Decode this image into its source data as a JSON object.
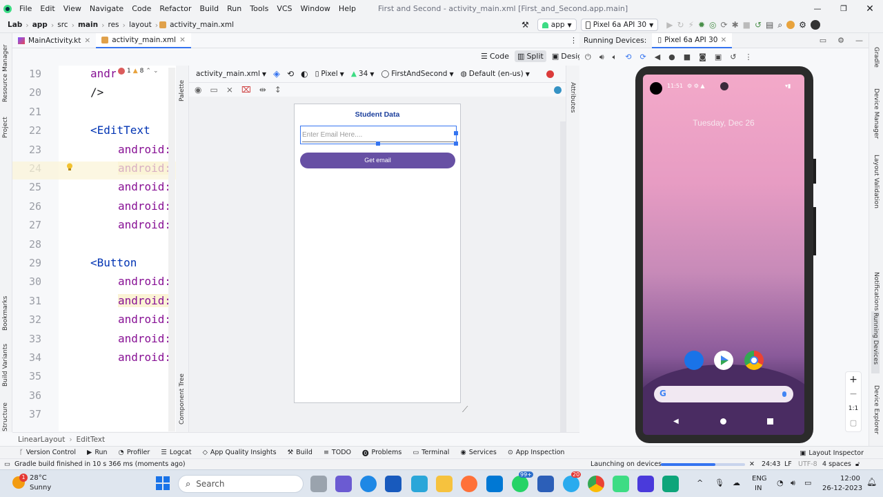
{
  "menu": [
    "File",
    "Edit",
    "View",
    "Navigate",
    "Code",
    "Refactor",
    "Build",
    "Run",
    "Tools",
    "VCS",
    "Window",
    "Help"
  ],
  "window_title": "First and Second - activity_main.xml [First_and_Second.app.main]",
  "breadcrumbs": [
    "Lab",
    "app",
    "src",
    "main",
    "res",
    "layout",
    "activity_main.xml"
  ],
  "run_config": "app",
  "device_selector": "Pixel 6a API 30",
  "file_tabs": [
    "MainActivity.kt",
    "activity_main.xml"
  ],
  "view_modes": {
    "code": "Code",
    "split": "Split",
    "design": "Design"
  },
  "left_stripe": [
    "Resource Manager",
    "Project",
    "Bookmarks",
    "Build Variants",
    "Structure"
  ],
  "editor": {
    "inspection": {
      "errors": "1",
      "warnings": "8"
    },
    "lines": [
      {
        "n": "19",
        "text": "andr"
      },
      {
        "n": "20",
        "text": "/>"
      },
      {
        "n": "21",
        "text": ""
      },
      {
        "n": "22",
        "text": "<EditText"
      },
      {
        "n": "23",
        "text": "android:"
      },
      {
        "n": "24",
        "text": "android:"
      },
      {
        "n": "25",
        "text": "android:"
      },
      {
        "n": "26",
        "text": "android:"
      },
      {
        "n": "27",
        "text": "android:"
      },
      {
        "n": "28",
        "text": ""
      },
      {
        "n": "29",
        "text": "<Button"
      },
      {
        "n": "30",
        "text": "android:"
      },
      {
        "n": "31",
        "text": "android:"
      },
      {
        "n": "32",
        "text": "android:"
      },
      {
        "n": "33",
        "text": "android:"
      },
      {
        "n": "34",
        "text": "android:"
      },
      {
        "n": "35",
        "text": ""
      },
      {
        "n": "36",
        "text": ""
      },
      {
        "n": "37",
        "text": ""
      }
    ]
  },
  "palette_label": "Palette",
  "component_tree_label": "Component Tree",
  "attributes_label": "Attributes",
  "design_toolbar": {
    "file": "activity_main.xml",
    "device": "Pixel",
    "api": "34",
    "theme": "FirstAndSecond",
    "locale": "Default (en-us)"
  },
  "preview": {
    "title": "Student Data",
    "email_hint": "Enter Email Here....",
    "button_label": "Get email"
  },
  "running_devices": {
    "label": "Running Devices:",
    "tab": "Pixel 6a API 30",
    "time": "11:51",
    "date": "Tuesday, Dec 26",
    "zoom_actual": "1:1"
  },
  "right_stripe": [
    "Gradle",
    "Device Manager",
    "Layout Validation",
    "Notifications",
    "Running Devices",
    "Device Explorer"
  ],
  "layout_breadcrumb": [
    "LinearLayout",
    "EditText"
  ],
  "tool_windows": [
    "Version Control",
    "Run",
    "Profiler",
    "Logcat",
    "App Quality Insights",
    "Build",
    "TODO",
    "Problems",
    "Terminal",
    "Services",
    "App Inspection",
    "Layout Inspector"
  ],
  "status": {
    "message": "Gradle build finished in 10 s 366 ms (moments ago)",
    "launching": "Launching on devices",
    "position": "24:43",
    "line_sep": "LF",
    "encoding": "UTF-8",
    "indent": "4 spaces"
  },
  "taskbar": {
    "weather_temp": "28°C",
    "weather_desc": "Sunny",
    "weather_badge": "1",
    "search_placeholder": "Search",
    "lang1": "ENG",
    "lang2": "IN",
    "time": "12:00",
    "date": "26-12-2023",
    "badge_99": "99+",
    "badge_20": "20"
  },
  "colors": {
    "accent": "#3574f0",
    "button": "#6750a4",
    "title": "#1a3e9c",
    "tag": "#0033b3",
    "attr": "#871094"
  }
}
